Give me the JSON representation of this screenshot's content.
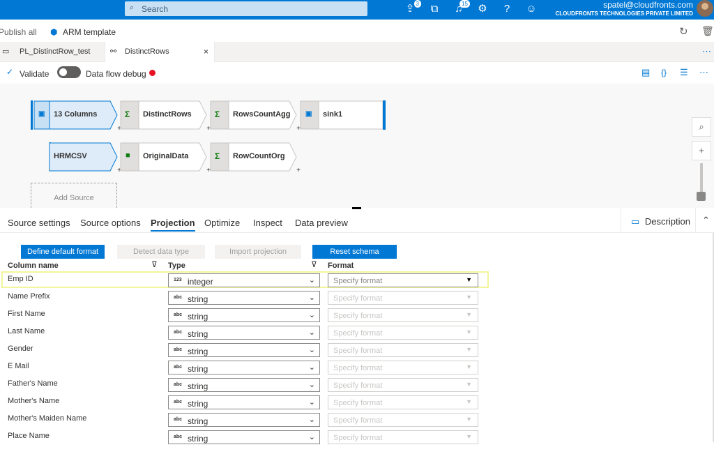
{
  "topbar": {
    "search_placeholder": "Search",
    "notifications_count_1": "3",
    "notifications_count_2": "15",
    "user_email": "spatel@cloudfronts.com",
    "org_name": "CLOUDFRONTS TECHNOLOGIES PRIVATE LIMITED"
  },
  "toolbar": {
    "publish_all": "Publish all",
    "arm_template": "ARM template"
  },
  "tabs": [
    {
      "label": "PL_DistinctRow_test"
    },
    {
      "label": "DistinctRows"
    }
  ],
  "actions": {
    "validate": "Validate",
    "debug": "Data flow debug"
  },
  "graph": {
    "row1": [
      "13 Columns",
      "DistinctRows",
      "RowsCountAgg",
      "sink1"
    ],
    "row2": [
      "HRMCSV",
      "OriginalData",
      "RowCountOrg"
    ],
    "add_source": "Add Source"
  },
  "panel_tabs": [
    "Source settings",
    "Source options",
    "Projection",
    "Optimize",
    "Inspect",
    "Data preview"
  ],
  "description_label": "Description",
  "buttons": {
    "define_default": "Define default format",
    "detect_type": "Detect data type",
    "import_projection": "Import projection",
    "reset_schema": "Reset schema"
  },
  "headers": {
    "column_name": "Column name",
    "type": "Type",
    "format": "Format"
  },
  "format_placeholder": "Specify format",
  "rows": [
    {
      "name": "Emp ID",
      "tag": "123",
      "type": "integer"
    },
    {
      "name": "Name Prefix",
      "tag": "abc",
      "type": "string"
    },
    {
      "name": "First Name",
      "tag": "abc",
      "type": "string"
    },
    {
      "name": "Last Name",
      "tag": "abc",
      "type": "string"
    },
    {
      "name": "Gender",
      "tag": "abc",
      "type": "string"
    },
    {
      "name": "E Mail",
      "tag": "abc",
      "type": "string"
    },
    {
      "name": "Father's Name",
      "tag": "abc",
      "type": "string"
    },
    {
      "name": "Mother's Name",
      "tag": "abc",
      "type": "string"
    },
    {
      "name": "Mother's Maiden Name",
      "tag": "abc",
      "type": "string"
    },
    {
      "name": "Place Name",
      "tag": "abc",
      "type": "string"
    }
  ]
}
